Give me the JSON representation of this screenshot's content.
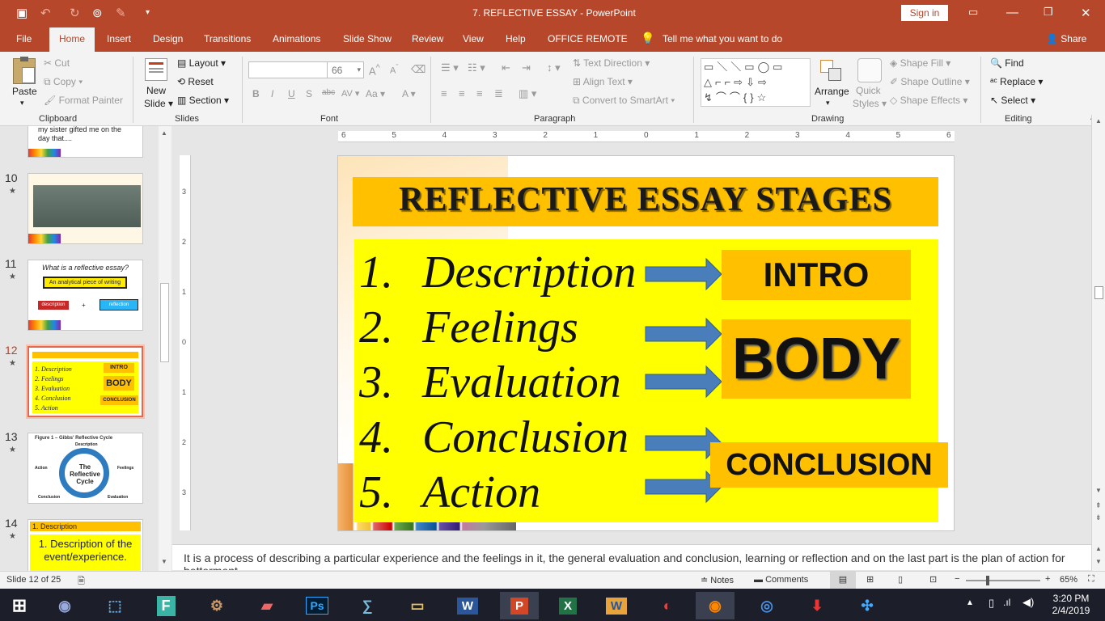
{
  "titlebar": {
    "title": "7. REFLECTIVE ESSAY  -  PowerPoint",
    "signin": "Sign in"
  },
  "tabs": [
    "File",
    "Home",
    "Insert",
    "Design",
    "Transitions",
    "Animations",
    "Slide Show",
    "Review",
    "View",
    "Help",
    "OFFICE REMOTE"
  ],
  "tellme": "Tell me what you want to do",
  "share": "Share",
  "ribbon": {
    "clipboard": {
      "paste": "Paste",
      "cut": "Cut",
      "copy": "Copy",
      "format_painter": "Format Painter",
      "label": "Clipboard"
    },
    "slides": {
      "new_slide_1": "New",
      "new_slide_2": "Slide",
      "layout": "Layout",
      "reset": "Reset",
      "section": "Section",
      "label": "Slides"
    },
    "font": {
      "size": "66",
      "label": "Font"
    },
    "paragraph": {
      "text_direction": "Text Direction",
      "align_text": "Align Text",
      "convert_smartart": "Convert to SmartArt",
      "label": "Paragraph"
    },
    "drawing": {
      "arrange": "Arrange",
      "quick_styles_1": "Quick",
      "quick_styles_2": "Styles",
      "shape_fill": "Shape Fill",
      "shape_outline": "Shape Outline",
      "shape_effects": "Shape Effects",
      "label": "Drawing"
    },
    "editing": {
      "find": "Find",
      "replace": "Replace",
      "select": "Select",
      "label": "Editing"
    }
  },
  "thumbnails": [
    {
      "num": "",
      "text": "my sister gifted me on the day that...."
    },
    {
      "num": "10",
      "text": ""
    },
    {
      "num": "11",
      "title": "What is a reflective essay?",
      "box": "An analytical piece of writing",
      "left": "description",
      "plus": "+",
      "right": "reflection"
    },
    {
      "num": "12",
      "items": [
        "1.  Description",
        "2.  Feelings",
        "3.  Evaluation",
        "4.  Conclusion",
        "5.  Action"
      ],
      "intro": "INTRO",
      "body": "BODY",
      "conclusion": "CONCLUSION"
    },
    {
      "num": "13",
      "title": "Figure 1 – Gibbs' Reflective Cycle",
      "center": "The Reflective Cycle",
      "labels": [
        "Description",
        "Feelings",
        "Evaluation",
        "Analysis",
        "Conclusion",
        "Action"
      ]
    },
    {
      "num": "14",
      "header": "1. Description",
      "text": "1. Description of the event/experience."
    }
  ],
  "slide": {
    "title": "REFLECTIVE ESSAY STAGES",
    "items": [
      {
        "num": "1.",
        "text": "Description"
      },
      {
        "num": "2.",
        "text": "Feelings"
      },
      {
        "num": "3.",
        "text": "Evaluation"
      },
      {
        "num": "4.",
        "text": "Conclusion"
      },
      {
        "num": "5.",
        "text": "Action"
      }
    ],
    "intro": "INTRO",
    "body": "BODY",
    "conclusion": "CONCLUSION"
  },
  "ruler_h": [
    "6",
    "5",
    "4",
    "3",
    "2",
    "1",
    "0",
    "1",
    "2",
    "3",
    "4",
    "5",
    "6"
  ],
  "ruler_v": [
    "3",
    "2",
    "1",
    "0",
    "1",
    "2",
    "3"
  ],
  "notes": "It is a process of describing a particular experience and the feelings in it, the general evaluation and conclusion, learning or reflection and on the last part is the plan of action for betterment",
  "status": {
    "slide": "Slide 12 of 25",
    "notes": "Notes",
    "comments": "Comments",
    "zoom": "65%"
  },
  "taskbar": {
    "time": "3:20 PM",
    "date": "2/4/2019",
    "apps": [
      "Ps",
      "W",
      "P",
      "X",
      "W"
    ]
  },
  "colors": {
    "accent": "#b7472a",
    "slide_yellow": "#ffff00",
    "slide_orange": "#ffc000",
    "arrow_blue": "#4a7ebb"
  }
}
